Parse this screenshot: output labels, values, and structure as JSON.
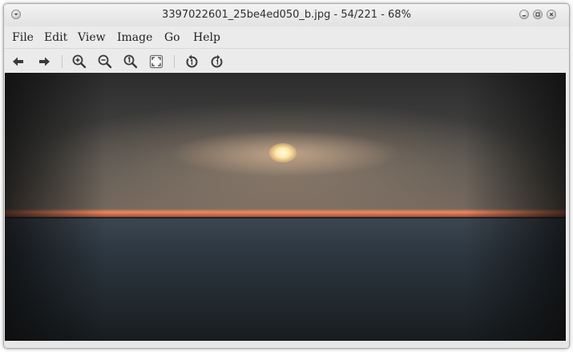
{
  "window": {
    "title": "3397022601_25be4ed050_b.jpg - 54/221 - 68%"
  },
  "menubar": {
    "items": [
      "File",
      "Edit",
      "View",
      "Image",
      "Go",
      "Help"
    ]
  },
  "toolbar": {
    "buttons": [
      {
        "name": "back",
        "icon": "arrow-left-icon"
      },
      {
        "name": "forward",
        "icon": "arrow-right-icon"
      },
      {
        "name": "zoom-in",
        "icon": "zoom-in-icon"
      },
      {
        "name": "zoom-out",
        "icon": "zoom-out-icon"
      },
      {
        "name": "zoom-normal",
        "icon": "zoom-100-icon"
      },
      {
        "name": "zoom-fit",
        "icon": "zoom-fit-icon"
      },
      {
        "name": "rotate-left",
        "icon": "rotate-ccw-icon"
      },
      {
        "name": "rotate-right",
        "icon": "rotate-cw-icon"
      }
    ]
  },
  "image": {
    "description_colors": {
      "sky": "#3d3d3c",
      "horizon": "#e26a45",
      "sea": "#2c3640"
    }
  }
}
